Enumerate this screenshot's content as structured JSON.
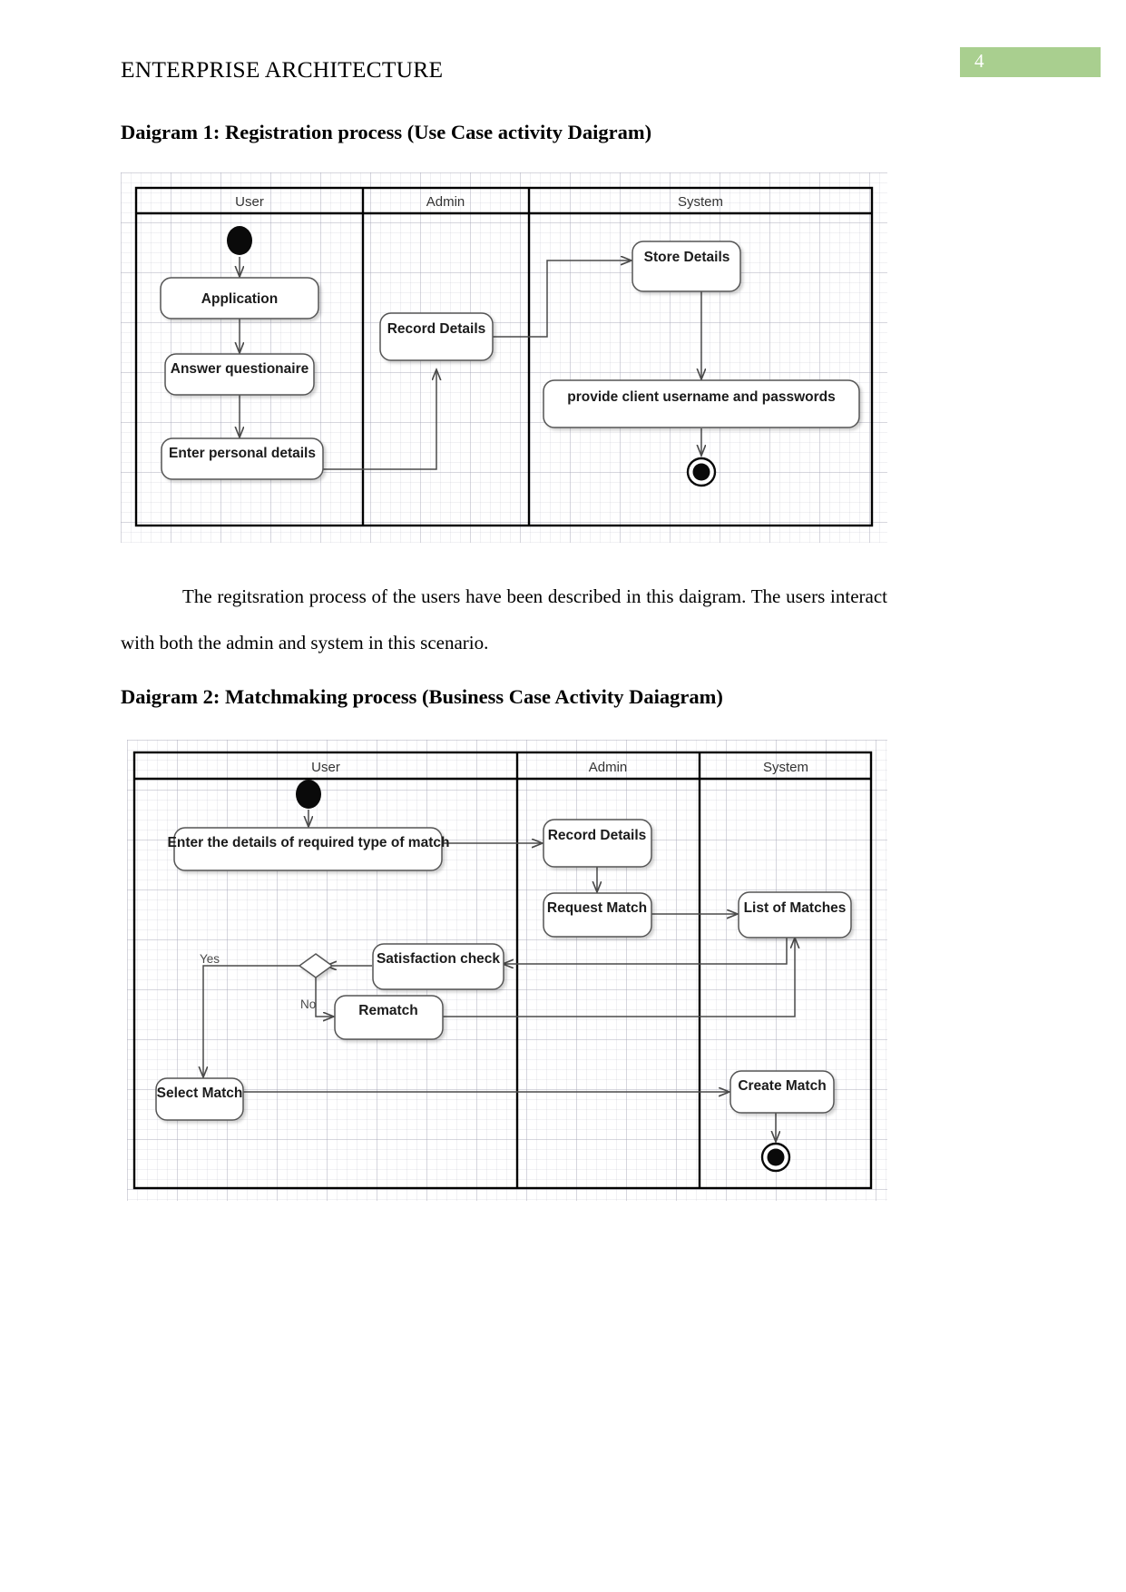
{
  "header": {
    "title": "ENTERPRISE ARCHITECTURE",
    "page_number": "4",
    "badge_color": "#a9cf8f"
  },
  "sections": [
    {
      "heading": "Daigram 1: Registration process (Use Case activity Daigram)"
    },
    {
      "heading": "Daigram 2: Matchmaking process (Business Case Activity Daiagram)"
    }
  ],
  "paragraphs": {
    "after_diagram_1": "The regitsration process of the users have been described in this daigram. The users interact with both the admin and system in this scenario."
  },
  "diagram1": {
    "lanes": [
      {
        "name": "User"
      },
      {
        "name": "Admin"
      },
      {
        "name": "System"
      }
    ],
    "nodes": {
      "start": "start-node",
      "application": "Application",
      "answer_questionaire": "Answer questionaire",
      "enter_personal_details": "Enter personal details",
      "record_details": "Record Details",
      "store_details": "Store Details",
      "provide_credentials": "provide client username and passwords",
      "end": "end-node"
    }
  },
  "diagram2": {
    "lanes": [
      {
        "name": "User"
      },
      {
        "name": "Admin"
      },
      {
        "name": "System"
      }
    ],
    "nodes": {
      "start": "start-node",
      "enter_match_details": "Enter the details of required type of match",
      "record_details": "Record Details",
      "request_match": "Request Match",
      "list_of_matches": "List of Matches",
      "satisfaction_check": "Satisfaction check",
      "decision": "decision-diamond",
      "rematch": "Rematch",
      "select_match": "Select Match",
      "create_match": "Create Match",
      "end": "end-node"
    },
    "guards": {
      "yes": "Yes",
      "no": "No"
    }
  }
}
